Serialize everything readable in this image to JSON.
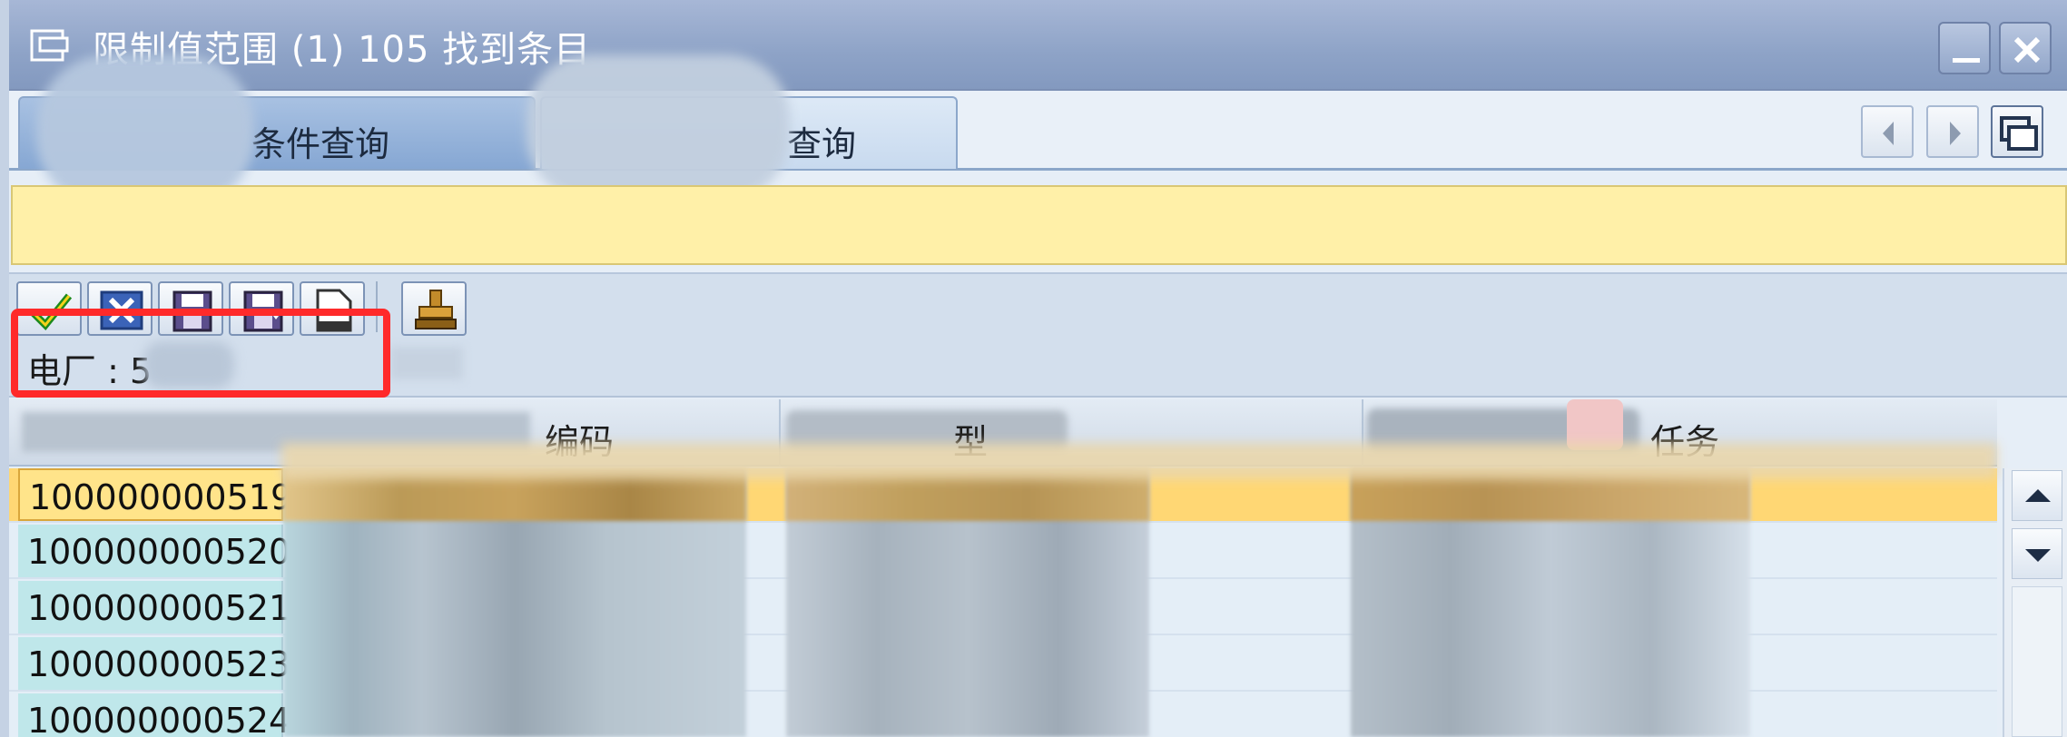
{
  "window": {
    "title": "限制值范围 (1)  105 找到条目"
  },
  "tabs": [
    {
      "label": "条件查询"
    },
    {
      "label": "查询"
    }
  ],
  "filter": {
    "label": "电厂 : 5"
  },
  "table": {
    "columns": [
      "编码",
      "型",
      "任务"
    ],
    "rows": [
      {
        "id": "100000000519",
        "selected": true
      },
      {
        "id": "100000000520",
        "selected": false
      },
      {
        "id": "100000000521",
        "selected": false
      },
      {
        "id": "100000000523",
        "selected": false
      },
      {
        "id": "100000000524",
        "selected": false
      }
    ]
  },
  "toolbar": {
    "icons": [
      "check-icon",
      "cancel-icon",
      "save-icon",
      "save-all-icon",
      "new-document-icon",
      "stamp-icon"
    ]
  },
  "colors": {
    "titlebar": "#8ea3c7",
    "message_band": "#fff0a8",
    "selected_row": "#ffd774",
    "key_cell": "#bfe7ea",
    "highlight": "#ff2a2a"
  }
}
